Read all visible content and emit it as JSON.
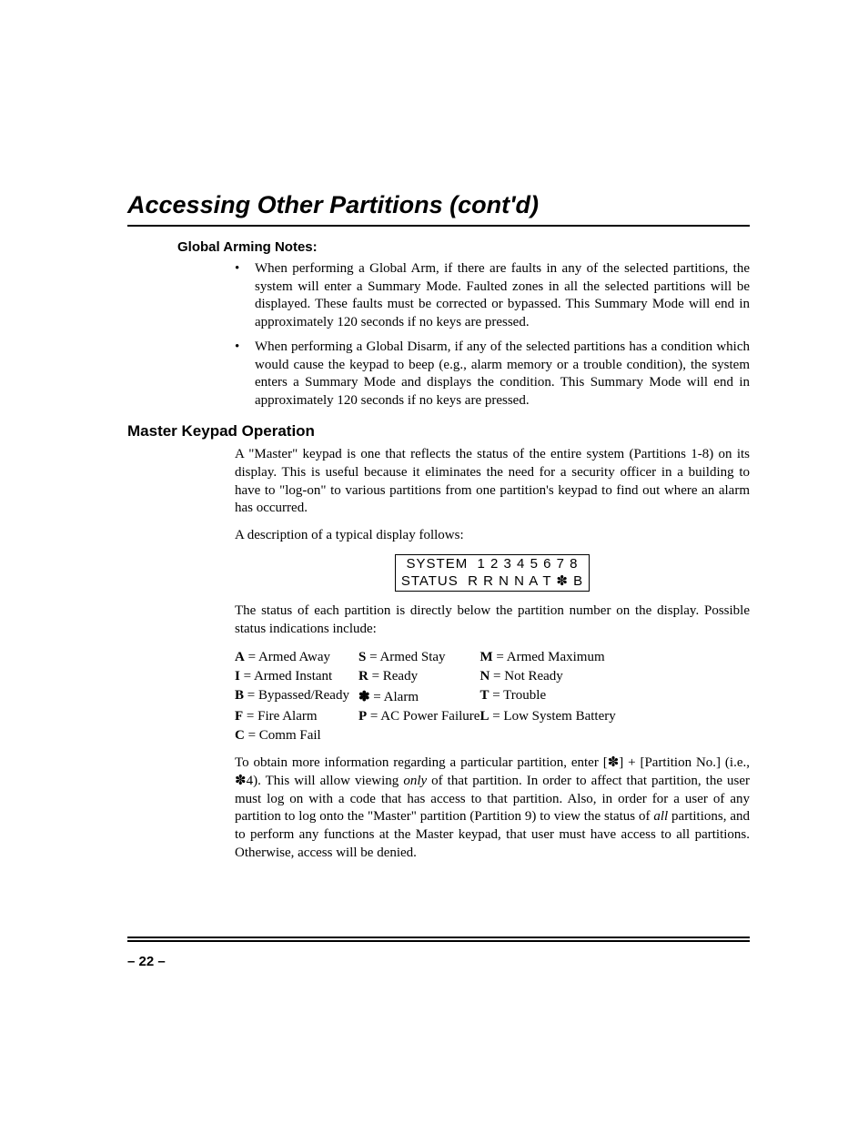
{
  "title": "Accessing Other Partitions (cont'd)",
  "globalArming": {
    "heading": "Global Arming Notes:",
    "bullets": [
      "When performing a Global Arm, if there are faults in any of the selected partitions, the system will enter a Summary Mode. Faulted zones in all the selected partitions will be displayed. These faults must be corrected or bypassed. This Summary Mode will end in approximately 120 seconds if no keys are pressed.",
      "When performing a Global Disarm, if any of the selected partitions has a condition which would cause the keypad to beep (e.g., alarm memory or a trouble condition), the system enters a Summary Mode and displays the condition. This Summary Mode will end in approximately 120 seconds if no keys are pressed."
    ]
  },
  "master": {
    "heading": "Master Keypad Operation",
    "p1": "A \"Master\" keypad is one that reflects the status of the entire system (Partitions 1-8) on its display.  This is useful because it eliminates the need for a security officer in a building to have to \"log-on\" to various partitions from one partition's keypad to find out where an alarm has occurred.",
    "p2": "A description of a typical display follows:",
    "display_line1": "SYSTEM  1 2 3 4 5 6 7 8",
    "display_line2": "STATUS  R R N N A T ✽ B",
    "p3": "The status of each partition is directly below the partition number on the display. Possible status indications include:",
    "status": {
      "r1": {
        "c1_k": "A",
        "c1_v": " = Armed Away",
        "c2_k": "S",
        "c2_v": " = Armed Stay",
        "c3_k": "M",
        "c3_v": " = Armed Maximum"
      },
      "r2": {
        "c1_k": "I",
        "c1_v": " = Armed Instant",
        "c2_k": "R",
        "c2_v": " = Ready",
        "c3_k": "N",
        "c3_v": " = Not Ready"
      },
      "r3": {
        "c1_k": "B",
        "c1_v": " = Bypassed/Ready",
        "c2_k": "✽",
        "c2_v": " = Alarm",
        "c3_k": "T",
        "c3_v": " = Trouble"
      },
      "r4": {
        "c1_k": "F",
        "c1_v": " = Fire Alarm",
        "c2_k": "P",
        "c2_v": " = AC Power Failure",
        "c3_k": "L",
        "c3_v": " = Low System Battery"
      },
      "r5": {
        "c1_k": "C",
        "c1_v": " = Comm Fail"
      }
    },
    "p4_a": "To obtain more information regarding a particular partition, enter [✽] + [Partition No.] (i.e., ✽4).  This will allow viewing ",
    "p4_i1": "only",
    "p4_b": " of that partition.  In order to affect that partition, the user must log on with a code that has access to that partition.  Also, in order for a user of any partition to log onto the \"Master\" partition (Partition 9) to view the status of ",
    "p4_i2": "all",
    "p4_c": " partitions, and to perform any functions at the Master keypad, that user must have access to all partitions.  Otherwise, access will be denied."
  },
  "pageNumber": "– 22 –"
}
